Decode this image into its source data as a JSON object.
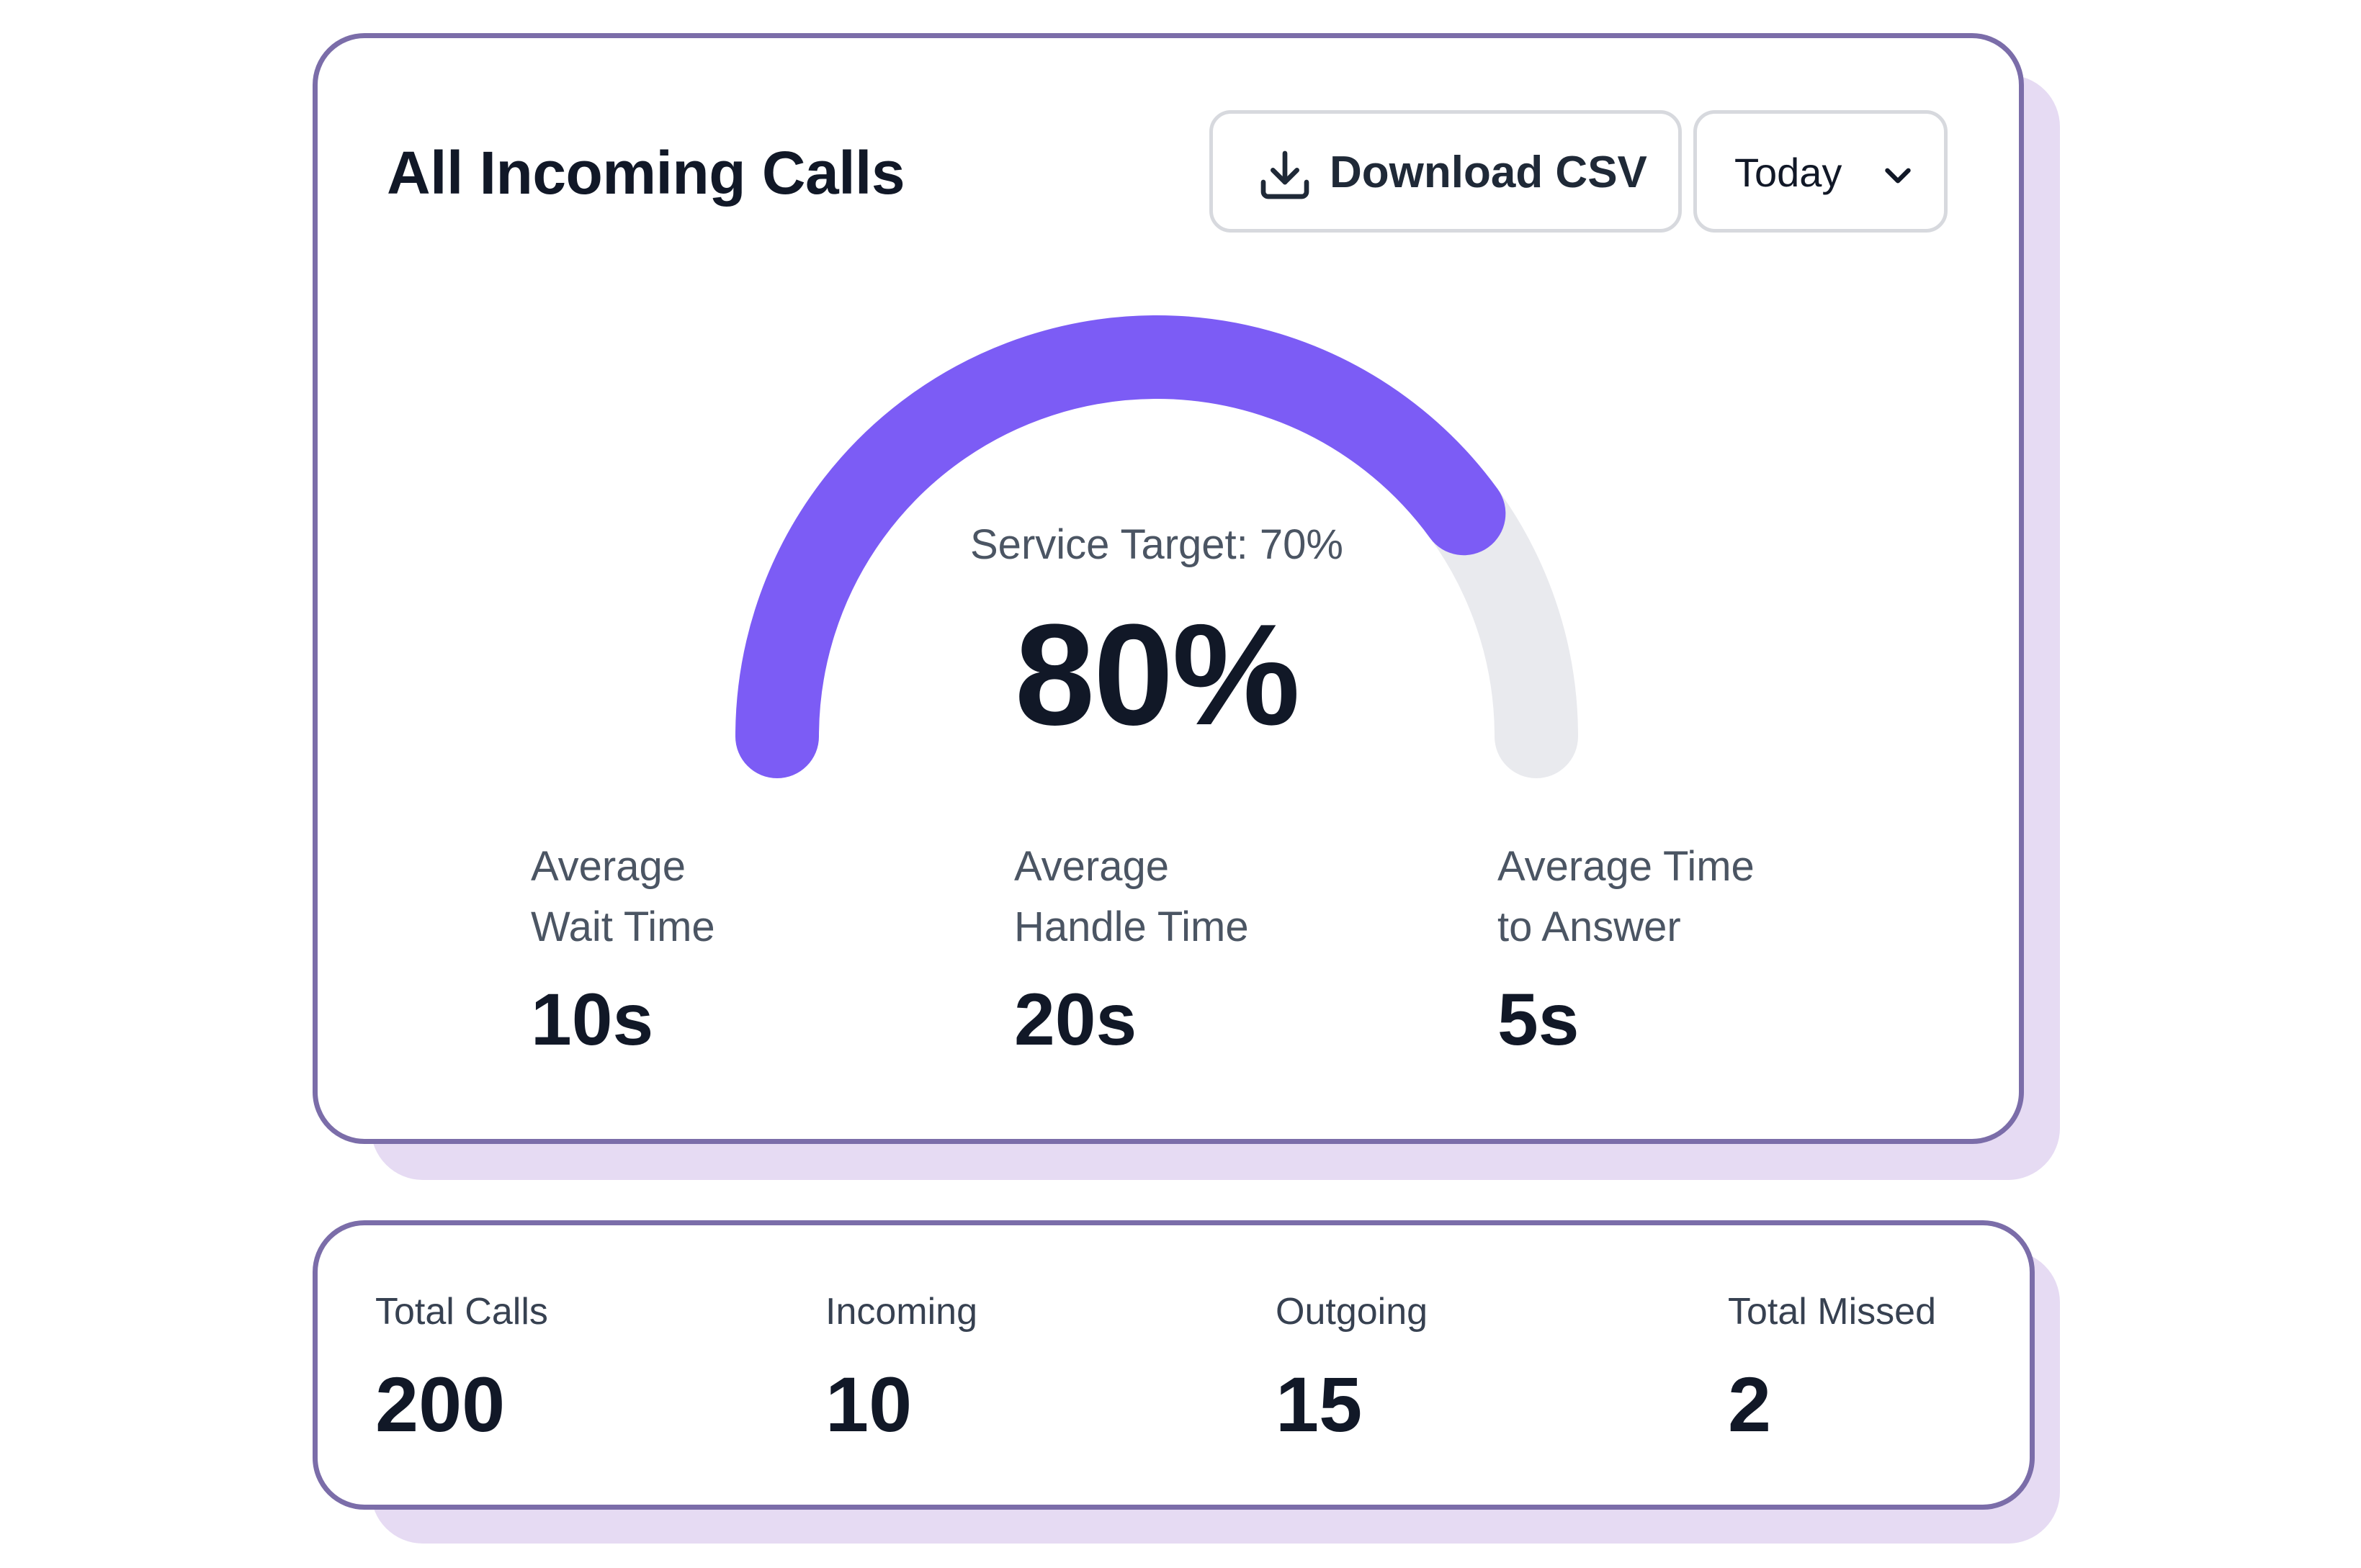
{
  "header": {
    "title": "All Incoming Calls",
    "download_label": "Download CSV",
    "period": "Today"
  },
  "gauge": {
    "service_target": "Service Target: 70%",
    "value_label": "80%",
    "value": 0.8,
    "fill_color": "#7c5cf5",
    "track_color": "#e9eaee"
  },
  "metrics": [
    {
      "label_line1": "Average",
      "label_line2": "Wait Time",
      "value": "10s"
    },
    {
      "label_line1": "Average",
      "label_line2": "Handle Time",
      "value": "20s"
    },
    {
      "label_line1": "Average Time",
      "label_line2": "to Answer",
      "value": "5s"
    }
  ],
  "stats": [
    {
      "label": "Total Calls",
      "value": "200"
    },
    {
      "label": "Incoming",
      "value": "10"
    },
    {
      "label": "Outgoing",
      "value": "15"
    },
    {
      "label": "Total Missed",
      "value": "2"
    }
  ],
  "colors": {
    "card_border": "#7b6da9",
    "shadow": "#e6dbf3",
    "accent": "#7c5cf5"
  }
}
